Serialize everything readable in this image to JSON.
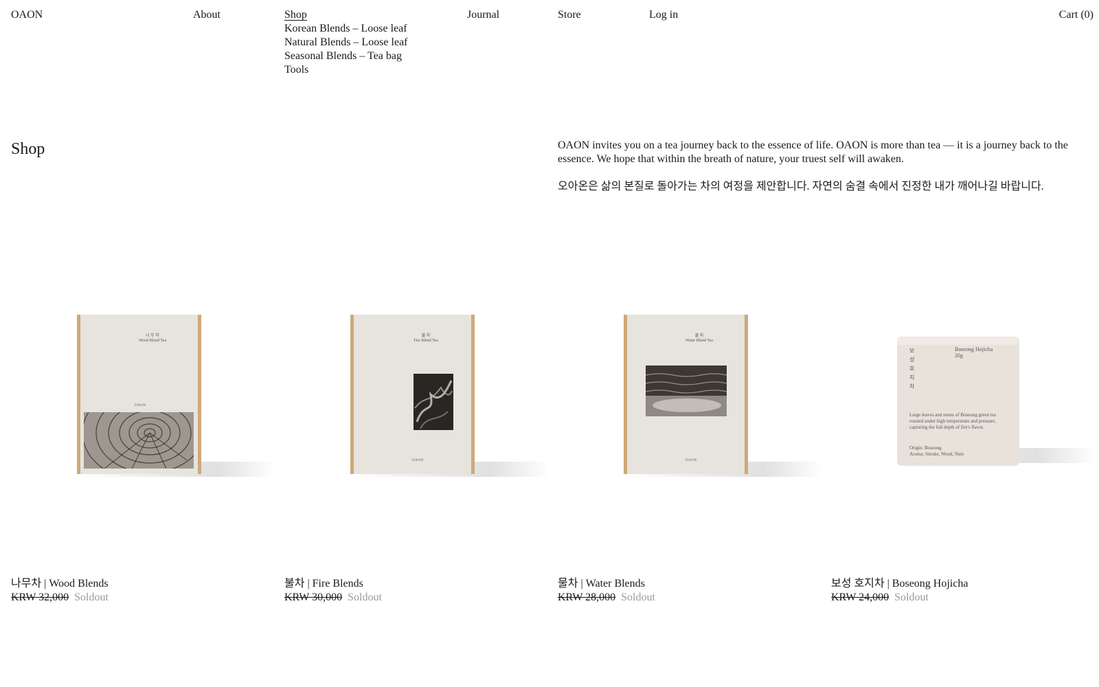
{
  "nav": {
    "logo": "OAON",
    "about": "About",
    "shop": "Shop",
    "shop_submenu": [
      "Korean Blends – Loose leaf",
      "Natural Blends – Loose leaf",
      "Seasonal Blends – Tea bag",
      "Tools"
    ],
    "journal": "Journal",
    "store": "Store",
    "login": "Log in",
    "cart": "Cart (0)"
  },
  "page": {
    "title": "Shop",
    "intro_en": "OAON invites you on a tea journey back to the essence of life. OAON is more than tea — it is a journey back to the essence. We hope that within the breath of nature, your truest self will awaken.",
    "intro_ko": "오아온은 삶의 본질로 돌아가는 차의 여정을 제안합니다. 자연의 숨결 속에서 진정한 내가 깨어나길 바랍니다."
  },
  "products": [
    {
      "name": "나무차 | Wood Blends",
      "price": "KRW 32,000",
      "status": "Soldout",
      "box_title_ko": "나 무 차",
      "box_title_en": "Wood Blend Tea",
      "box_logo": "OAON"
    },
    {
      "name": "불차 | Fire Blends",
      "price": "KRW 30,000",
      "status": "Soldout",
      "box_title_ko": "불 차",
      "box_title_en": "Fire Blend Tea",
      "box_logo": "OAON"
    },
    {
      "name": "물차 | Water Blends",
      "price": "KRW 28,000",
      "status": "Soldout",
      "box_title_ko": "물 차",
      "box_title_en": "Water Blend Tea",
      "box_logo": "OAON"
    },
    {
      "name": "보성 호지차 | Boseong Hojicha",
      "price": "KRW 24,000",
      "status": "Soldout",
      "tin_vertical": "보 성 호 지 차",
      "tin_title": "Boseong Hojicha",
      "tin_weight": "20g",
      "tin_desc": "Large leaves and stems of Boseong green tea roasted under high temperature and pressure, capturing the full depth of fire's flavor.",
      "tin_origin": "Origin: Boseong",
      "tin_aroma": "Aroma: Smoke, Wood, Nuts"
    }
  ]
}
